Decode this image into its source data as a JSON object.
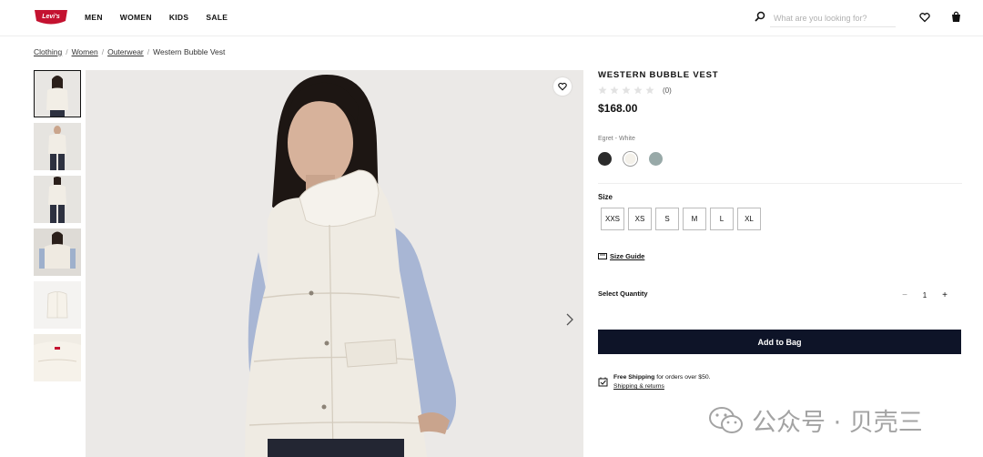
{
  "header": {
    "logo_text": "Levi's",
    "brand_color": "#c41230",
    "nav": [
      "MEN",
      "WOMEN",
      "KIDS",
      "SALE"
    ],
    "search_placeholder": "What are you looking for?"
  },
  "breadcrumb": {
    "items": [
      "Clothing",
      "Women",
      "Outerwear"
    ],
    "current": "Western Bubble Vest"
  },
  "gallery": {
    "thumbnail_count": 6,
    "active_index": 0
  },
  "product": {
    "title": "WESTERN BUBBLE VEST",
    "rating_count": "(0)",
    "rating": 0,
    "price": "$168.00",
    "color_label": "Egret - White",
    "swatches": [
      {
        "name": "black",
        "color": "#2b2b2b"
      },
      {
        "name": "egret-white",
        "color": "#f4f1ea",
        "selected": true
      },
      {
        "name": "sage-gray",
        "color": "#98a9a8"
      }
    ],
    "size_label": "Size",
    "sizes": [
      "XXS",
      "XS",
      "S",
      "M",
      "L",
      "XL"
    ],
    "size_guide": "Size Guide",
    "quantity_label": "Select Quantity",
    "quantity_minus": "−",
    "quantity": "1",
    "quantity_plus": "+",
    "add_to_bag": "Add to Bag",
    "shipping_bold": "Free Shipping",
    "shipping_text": " for orders over $50.",
    "shipping_link": "Shipping & returns",
    "button_color": "#0e1428"
  },
  "watermark": "公众号 · 贝壳三"
}
